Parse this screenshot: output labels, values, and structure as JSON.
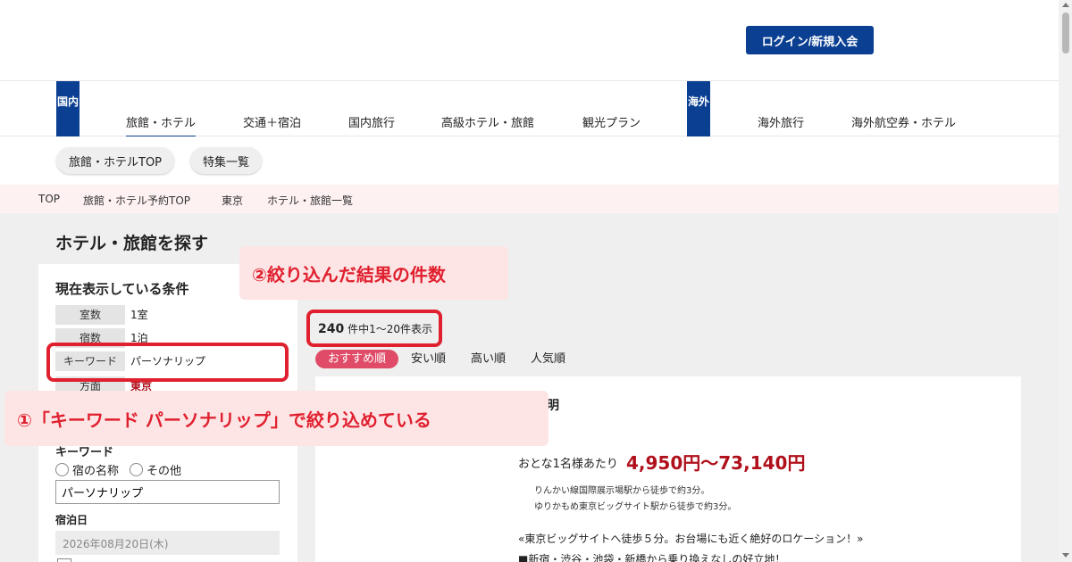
{
  "header": {
    "login_button": "ログイン/新規入会"
  },
  "global_nav": {
    "domestic_tag": "国内",
    "overseas_tag": "海外",
    "domestic_items": [
      "旅館・ホテル",
      "交通＋宿泊",
      "国内旅行",
      "高級ホテル・旅館",
      "観光プラン"
    ],
    "overseas_items": [
      "海外旅行",
      "海外航空券・ホテル"
    ],
    "active_item": "旅館・ホテル"
  },
  "sub_nav": {
    "pills": [
      "旅館・ホテルTOP",
      "特集一覧"
    ]
  },
  "breadcrumb": [
    "TOP",
    "旅館・ホテル予約TOP",
    "東京",
    "ホテル・旅館一覧"
  ],
  "page_title": "ホテル・旅館を探す",
  "conditions": {
    "heading": "現在表示している条件",
    "rows": [
      {
        "label": "室数",
        "value": "1室"
      },
      {
        "label": "宿数",
        "value": "1泊"
      },
      {
        "label": "キーワード",
        "value": "パーソナリップ"
      },
      {
        "label": "方面",
        "value": "東京"
      }
    ]
  },
  "search_form": {
    "keyword_heading": "キーワード",
    "radio_options": [
      "宿の名称",
      "その他"
    ],
    "keyword_value": "パーソナリップ",
    "date_heading": "宿泊日",
    "date_value": "2026年08月20日(木)"
  },
  "results": {
    "count": "240",
    "count_suffix": "件中1～20件表示",
    "sort_tabs": [
      "おすすめ順",
      "安い順",
      "高い順",
      "人気順"
    ],
    "active_sort": "おすすめ順"
  },
  "result_card": {
    "hotel_name_partial": "明",
    "price_label": "おとな1名様あたり",
    "price": "4,950円～73,140円",
    "access": [
      "りんかい線国際展示場駅から徒歩で約3分。",
      "ゆりかもめ東京ビッグサイト駅から徒歩で約3分。"
    ],
    "catch_copy": "«東京ビッグサイトへ徒歩５分。お台場にも近く絶好のロケーション！»",
    "feature": "■新宿・渋谷・池袋・新橋から乗り換えなしの好立地！"
  },
  "annotations": {
    "callout_1": "①「キーワード パーソナリップ」で絞り込めている",
    "callout_2": "②絞り込んだ結果の件数"
  },
  "colors": {
    "brand_blue": "#0b3f92",
    "sort_active": "#e04c68",
    "price_red": "#b0101b",
    "annotation_red": "#e0202f"
  }
}
